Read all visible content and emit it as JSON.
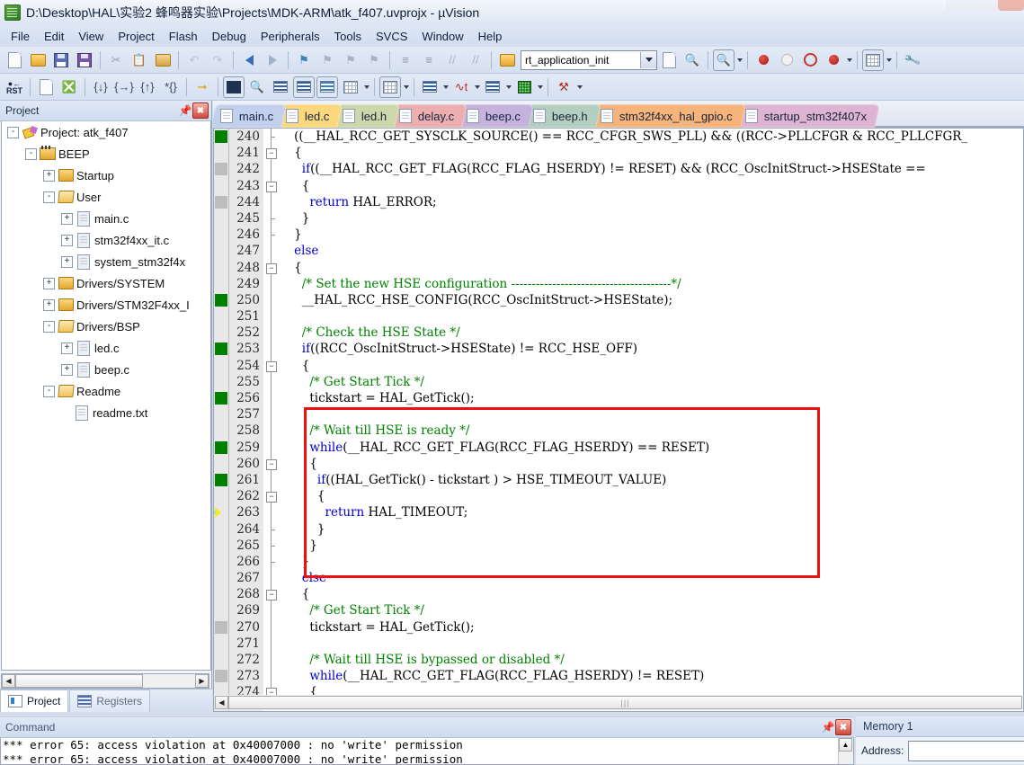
{
  "window": {
    "title": "D:\\Desktop\\HAL\\实验2 蜂鸣器实验\\Projects\\MDK-ARM\\atk_f407.uvprojx - µVision",
    "app_icon": "uvision-icon",
    "minimize_label": "",
    "maximize_label": "",
    "close_label": ""
  },
  "menu": {
    "items": [
      {
        "label": "File"
      },
      {
        "label": "Edit"
      },
      {
        "label": "View"
      },
      {
        "label": "Project"
      },
      {
        "label": "Flash"
      },
      {
        "label": "Debug"
      },
      {
        "label": "Peripherals"
      },
      {
        "label": "Tools"
      },
      {
        "label": "SVCS"
      },
      {
        "label": "Window"
      },
      {
        "label": "Help"
      }
    ]
  },
  "toolbar_main": {
    "function_combo_value": "rt_application_init",
    "buttons": [
      {
        "name": "new-file-button"
      },
      {
        "name": "open-file-button"
      },
      {
        "name": "save-button"
      },
      {
        "name": "save-all-button"
      },
      {
        "name": "cut-button"
      },
      {
        "name": "copy-button"
      },
      {
        "name": "paste-button"
      },
      {
        "name": "undo-button"
      },
      {
        "name": "redo-button"
      },
      {
        "name": "navigate-back-button"
      },
      {
        "name": "navigate-forward-button"
      },
      {
        "name": "insert-bookmark-button"
      },
      {
        "name": "prev-bookmark-button"
      },
      {
        "name": "next-bookmark-button"
      },
      {
        "name": "clear-bookmarks-button"
      },
      {
        "name": "indent-button"
      },
      {
        "name": "outdent-button"
      },
      {
        "name": "comment-button"
      },
      {
        "name": "uncomment-button"
      },
      {
        "name": "open-folder-button"
      },
      {
        "name": "goto-definition-button"
      },
      {
        "name": "find-in-files-button"
      },
      {
        "name": "find-button"
      },
      {
        "name": "insert-breakpoint-button"
      },
      {
        "name": "disable-breakpoint-button"
      },
      {
        "name": "kill-all-breakpoints-button"
      },
      {
        "name": "disable-all-breakpoints-button"
      },
      {
        "name": "manage-components-button"
      },
      {
        "name": "configure-target-button"
      }
    ]
  },
  "toolbar_debug": {
    "buttons": [
      {
        "name": "reset-cpu-button"
      },
      {
        "name": "run-to-main-button"
      },
      {
        "name": "stop-button"
      },
      {
        "name": "step-into-button"
      },
      {
        "name": "step-over-button"
      },
      {
        "name": "step-out-button"
      },
      {
        "name": "run-to-cursor-button"
      },
      {
        "name": "show-next-statement-button"
      },
      {
        "name": "command-window-button"
      },
      {
        "name": "disassembly-window-button"
      },
      {
        "name": "symbols-window-button"
      },
      {
        "name": "registers-window-button"
      },
      {
        "name": "call-stack-window-button"
      },
      {
        "name": "watch-window-button"
      },
      {
        "name": "memory-window-button"
      },
      {
        "name": "serial-window-button"
      },
      {
        "name": "analysis-window-button"
      },
      {
        "name": "trace-window-button"
      },
      {
        "name": "system-viewer-button"
      },
      {
        "name": "toolbox-button"
      }
    ]
  },
  "project_panel": {
    "title": "Project",
    "pin_label": "",
    "close_label": "",
    "tree": [
      {
        "label": "Project: atk_f407",
        "depth": 0,
        "icon": "project-icon",
        "toggle": "-"
      },
      {
        "label": "BEEP",
        "depth": 1,
        "icon": "target-icon",
        "toggle": "-"
      },
      {
        "label": "Startup",
        "depth": 2,
        "icon": "folder-closed-icon",
        "toggle": "+"
      },
      {
        "label": "User",
        "depth": 2,
        "icon": "folder-open-icon",
        "toggle": "-"
      },
      {
        "label": "main.c",
        "depth": 3,
        "icon": "c-file-icon",
        "toggle": "+"
      },
      {
        "label": "stm32f4xx_it.c",
        "depth": 3,
        "icon": "c-file-icon",
        "toggle": "+"
      },
      {
        "label": "system_stm32f4x",
        "depth": 3,
        "icon": "c-file-icon",
        "toggle": "+"
      },
      {
        "label": "Drivers/SYSTEM",
        "depth": 2,
        "icon": "folder-closed-icon",
        "toggle": "+"
      },
      {
        "label": "Drivers/STM32F4xx_I",
        "depth": 2,
        "icon": "folder-closed-icon",
        "toggle": "+"
      },
      {
        "label": "Drivers/BSP",
        "depth": 2,
        "icon": "folder-open-icon",
        "toggle": "-"
      },
      {
        "label": "led.c",
        "depth": 3,
        "icon": "c-file-icon",
        "toggle": "+"
      },
      {
        "label": "beep.c",
        "depth": 3,
        "icon": "c-file-icon",
        "toggle": "+"
      },
      {
        "label": "Readme",
        "depth": 2,
        "icon": "folder-open-icon",
        "toggle": "-"
      },
      {
        "label": "readme.txt",
        "depth": 3,
        "icon": "text-file-icon",
        "toggle": ""
      }
    ],
    "tabs": [
      {
        "label": "Project",
        "active": true,
        "icon": "project-tab-icon"
      },
      {
        "label": "Registers",
        "active": false,
        "icon": "registers-tab-icon"
      }
    ]
  },
  "editor": {
    "tabs": [
      {
        "label": "main.c",
        "color": "#c2d0ee",
        "active": true
      },
      {
        "label": "led.c",
        "color": "#fbd77e",
        "active": false
      },
      {
        "label": "led.h",
        "color": "#ccd7ac",
        "active": false
      },
      {
        "label": "delay.c",
        "color": "#edaeb0",
        "active": false
      },
      {
        "label": "beep.c",
        "color": "#c6b3dd",
        "active": false
      },
      {
        "label": "beep.h",
        "color": "#b4cfc0",
        "active": false
      },
      {
        "label": "stm32f4xx_hal_gpio.c",
        "color": "#f6b37a",
        "active": false
      },
      {
        "label": "startup_stm32f407x",
        "color": "#dfb4d2",
        "active": false
      }
    ],
    "highlight_box": {
      "color": "#ee1111",
      "from_line": 257,
      "to_line": 266
    },
    "scroll_grip": "|||",
    "lines": [
      {
        "n": 240,
        "marker": "green",
        "fold": "tick",
        "text": "    ((__HAL_RCC_GET_SYSCLK_SOURCE() == RCC_CFGR_SWS_PLL) && ((RCC->PLLCFGR & RCC_PLLCFGR_"
      },
      {
        "n": 241,
        "marker": "none",
        "fold": "minus",
        "text": "    {"
      },
      {
        "n": 242,
        "marker": "gray",
        "fold": "line",
        "text": "      if((__HAL_RCC_GET_FLAG(RCC_FLAG_HSERDY) != RESET) && (RCC_OscInitStruct->HSEState =="
      },
      {
        "n": 243,
        "marker": "none",
        "fold": "minus",
        "text": "      {"
      },
      {
        "n": 244,
        "marker": "gray",
        "fold": "line",
        "text": "        return HAL_ERROR;"
      },
      {
        "n": 245,
        "marker": "none",
        "fold": "tick",
        "text": "      }"
      },
      {
        "n": 246,
        "marker": "none",
        "fold": "tick",
        "text": "    }"
      },
      {
        "n": 247,
        "marker": "none",
        "fold": "line",
        "text": "    else"
      },
      {
        "n": 248,
        "marker": "none",
        "fold": "minus",
        "text": "    {"
      },
      {
        "n": 249,
        "marker": "none",
        "fold": "line",
        "text": "      /* Set the new HSE configuration ---------------------------------------*/"
      },
      {
        "n": 250,
        "marker": "green",
        "fold": "line",
        "text": "      __HAL_RCC_HSE_CONFIG(RCC_OscInitStruct->HSEState);"
      },
      {
        "n": 251,
        "marker": "none",
        "fold": "line",
        "text": ""
      },
      {
        "n": 252,
        "marker": "none",
        "fold": "line",
        "text": "      /* Check the HSE State */"
      },
      {
        "n": 253,
        "marker": "green",
        "fold": "line",
        "text": "      if((RCC_OscInitStruct->HSEState) != RCC_HSE_OFF)"
      },
      {
        "n": 254,
        "marker": "none",
        "fold": "minus",
        "text": "      {"
      },
      {
        "n": 255,
        "marker": "none",
        "fold": "line",
        "text": "        /* Get Start Tick */"
      },
      {
        "n": 256,
        "marker": "green",
        "fold": "line",
        "text": "        tickstart = HAL_GetTick();"
      },
      {
        "n": 257,
        "marker": "none",
        "fold": "line",
        "text": ""
      },
      {
        "n": 258,
        "marker": "none",
        "fold": "line",
        "text": "        /* Wait till HSE is ready */"
      },
      {
        "n": 259,
        "marker": "green",
        "fold": "line",
        "text": "        while(__HAL_RCC_GET_FLAG(RCC_FLAG_HSERDY) == RESET)"
      },
      {
        "n": 260,
        "marker": "none",
        "fold": "minus",
        "text": "        {"
      },
      {
        "n": 261,
        "marker": "green",
        "fold": "line",
        "text": "          if((HAL_GetTick() - tickstart ) > HSE_TIMEOUT_VALUE)"
      },
      {
        "n": 262,
        "marker": "none",
        "fold": "minus",
        "text": "          {"
      },
      {
        "n": 263,
        "marker": "arrow",
        "fold": "line",
        "text": "            return HAL_TIMEOUT;"
      },
      {
        "n": 264,
        "marker": "none",
        "fold": "tick",
        "text": "          }"
      },
      {
        "n": 265,
        "marker": "none",
        "fold": "tick",
        "text": "        }"
      },
      {
        "n": 266,
        "marker": "none",
        "fold": "tick",
        "text": "      }"
      },
      {
        "n": 267,
        "marker": "none",
        "fold": "line",
        "text": "      else"
      },
      {
        "n": 268,
        "marker": "none",
        "fold": "minus",
        "text": "      {"
      },
      {
        "n": 269,
        "marker": "none",
        "fold": "line",
        "text": "        /* Get Start Tick */"
      },
      {
        "n": 270,
        "marker": "gray",
        "fold": "line",
        "text": "        tickstart = HAL_GetTick();"
      },
      {
        "n": 271,
        "marker": "none",
        "fold": "line",
        "text": ""
      },
      {
        "n": 272,
        "marker": "none",
        "fold": "line",
        "text": "        /* Wait till HSE is bypassed or disabled */"
      },
      {
        "n": 273,
        "marker": "gray",
        "fold": "line",
        "text": "        while(__HAL_RCC_GET_FLAG(RCC_FLAG_HSERDY) != RESET)"
      },
      {
        "n": 274,
        "marker": "none",
        "fold": "minus",
        "text": "        {"
      }
    ]
  },
  "command_pane": {
    "title": "Command",
    "pin_label": "",
    "close_label": "",
    "lines": [
      "*** error 65: access violation at 0x40007000 : no 'write' permission",
      "*** error 65: access violation at 0x40007000 : no 'write' permission"
    ]
  },
  "memory_pane": {
    "title": "Memory 1",
    "address_label": "Address:",
    "address_value": "",
    "address_placeholder": ""
  }
}
